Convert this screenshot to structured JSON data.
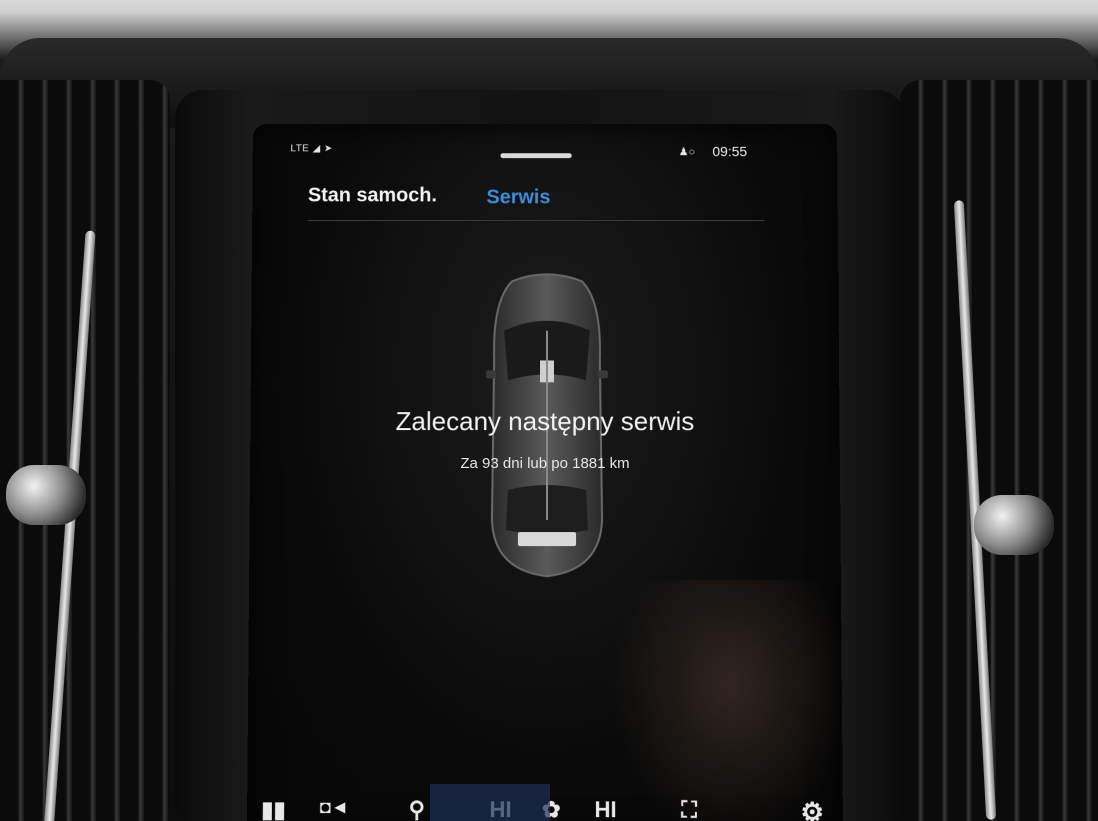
{
  "status_bar": {
    "network": "LTE",
    "time": "09:55"
  },
  "tabs": {
    "car_status": "Stan samoch.",
    "service": "Serwis"
  },
  "service": {
    "title": "Zalecany następny serwis",
    "detail": "Za 93 dni lub po 1881 km"
  },
  "climate_bar": {
    "left_seat_heat": "HI",
    "right_seat_heat": "HI"
  },
  "icons": {
    "user": "person-icon",
    "settings": "gear-icon",
    "fan": "fan-icon",
    "seat": "seat-icon",
    "camera": "camera-icon"
  },
  "colors": {
    "active_tab": "#3d8ddb",
    "text": "#f2f2f2",
    "background": "#0a0a0a"
  }
}
